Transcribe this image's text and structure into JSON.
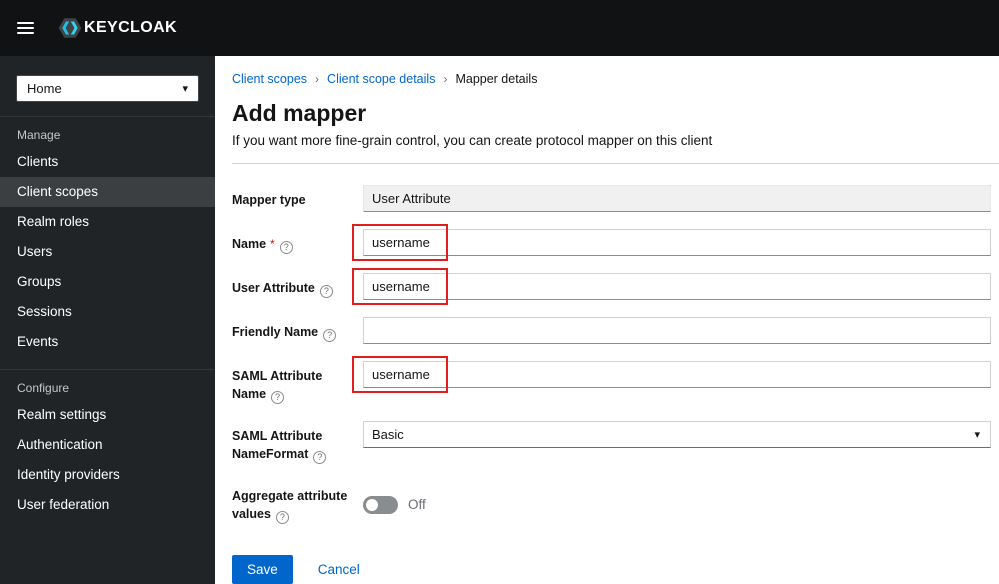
{
  "topbar": {
    "brand": "KEYCLOAK"
  },
  "icons": {
    "caret": "▾",
    "help": "?",
    "breadcrumb_separator": "›"
  },
  "sidebar": {
    "realm": "Home",
    "selected_item": "Client scopes",
    "sections": [
      {
        "label": "Manage",
        "items": [
          "Clients",
          "Client scopes",
          "Realm roles",
          "Users",
          "Groups",
          "Sessions",
          "Events"
        ]
      },
      {
        "label": "Configure",
        "items": [
          "Realm settings",
          "Authentication",
          "Identity providers",
          "User federation"
        ]
      }
    ]
  },
  "breadcrumb": [
    "Client scopes",
    "Client scope details",
    "Mapper details"
  ],
  "page": {
    "title": "Add mapper",
    "subtitle": "If you want more fine-grain control, you can create protocol mapper on this client"
  },
  "form": {
    "required_indicator": "*",
    "fields": [
      {
        "label": "Mapper type",
        "type": "readonly-text",
        "value": "User Attribute"
      },
      {
        "label": "Name",
        "type": "text",
        "value": "username",
        "required": true,
        "help": true,
        "highlighted": true
      },
      {
        "label": "User Attribute",
        "type": "text",
        "value": "username",
        "help": true,
        "highlighted": true
      },
      {
        "label": "Friendly Name",
        "type": "text",
        "value": "",
        "help": true
      },
      {
        "label": "SAML Attribute Name",
        "type": "text",
        "value": "username",
        "help": true,
        "highlighted": true
      },
      {
        "label": "SAML Attribute NameFormat",
        "type": "select",
        "value": "Basic",
        "help": true
      },
      {
        "label": "Aggregate attribute values",
        "type": "toggle",
        "value": "Off",
        "help": true
      }
    ],
    "save_label": "Save",
    "cancel_label": "Cancel"
  },
  "colors": {
    "accent": "#0066cc",
    "annotation": "#e01e1e",
    "topbar_bg": "#101214",
    "sidebar_bg": "#212427",
    "nav_selected": "#3c3f42",
    "required": "#c9190b"
  }
}
